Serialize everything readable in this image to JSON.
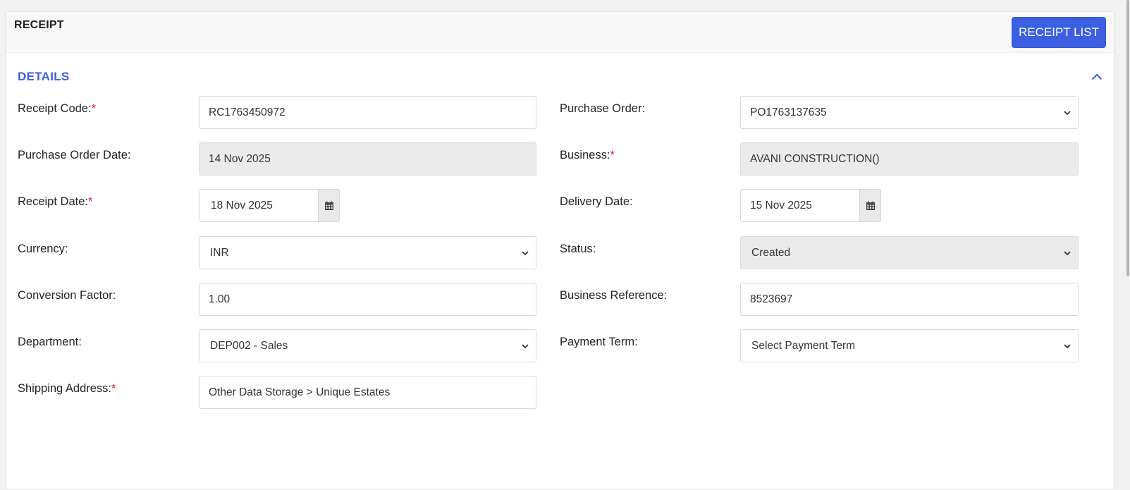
{
  "header": {
    "title": "RECEIPT",
    "list_button": "RECEIPT LIST"
  },
  "section": {
    "title": "DETAILS",
    "toggle_icon": "chevron-up-icon"
  },
  "required_marker": "*",
  "fields": {
    "receipt_code": {
      "label": "Receipt Code:",
      "required": true,
      "value": "RC1763450972"
    },
    "purchase_order": {
      "label": "Purchase Order:",
      "required": false,
      "value": "PO1763137635"
    },
    "purchase_order_date": {
      "label": "Purchase Order Date:",
      "required": false,
      "value": "14 Nov 2025"
    },
    "business": {
      "label": "Business:",
      "required": true,
      "value": "AVANI CONSTRUCTION()"
    },
    "receipt_date": {
      "label": "Receipt Date:",
      "required": true,
      "value": "18 Nov 2025"
    },
    "delivery_date": {
      "label": "Delivery Date:",
      "required": false,
      "value": "15 Nov 2025"
    },
    "currency": {
      "label": "Currency:",
      "required": false,
      "value": "INR"
    },
    "status": {
      "label": "Status:",
      "required": false,
      "value": "Created"
    },
    "conversion_factor": {
      "label": "Conversion Factor:",
      "required": false,
      "value": "1.00"
    },
    "business_reference": {
      "label": "Business Reference:",
      "required": false,
      "value": "8523697"
    },
    "department": {
      "label": "Department:",
      "required": false,
      "value": "DEP002 - Sales"
    },
    "payment_term": {
      "label": "Payment Term:",
      "required": false,
      "value": "Select Payment Term"
    },
    "shipping_address": {
      "label": "Shipping Address:",
      "required": true,
      "value": "Other Data Storage > Unique Estates"
    }
  },
  "colors": {
    "accent": "#3b5fe0",
    "required": "#e02020",
    "readonly_bg": "#ebebeb"
  }
}
